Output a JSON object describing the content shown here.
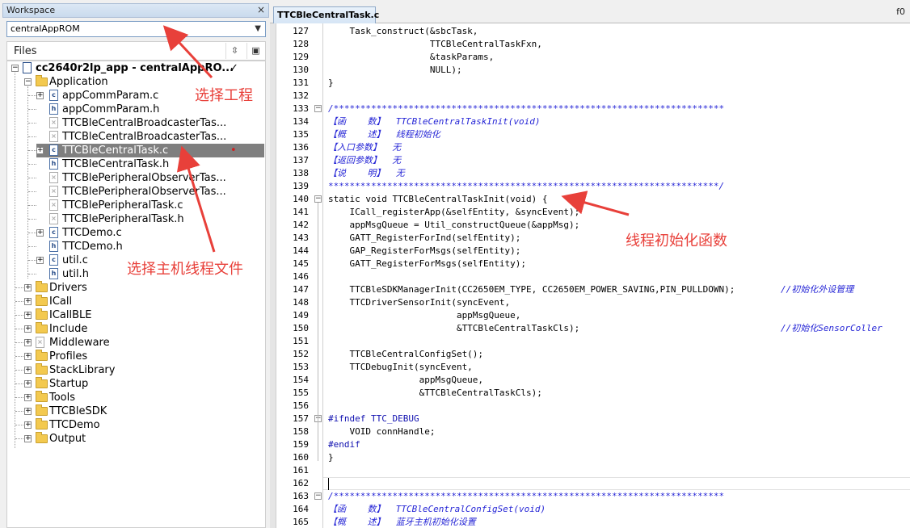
{
  "workspace": {
    "title": "Workspace",
    "close": "×",
    "config": "centralAppROM",
    "files_label": "Files",
    "btn_a": "⇳",
    "btn_b": "▣"
  },
  "tree": {
    "project": "cc2640r2lp_app - centralAppRO...",
    "project_check": "✓",
    "application": "Application",
    "items": [
      {
        "label": "appCommParam.c",
        "icon": "c",
        "exp": true
      },
      {
        "label": "appCommParam.h",
        "icon": "h",
        "exp": false
      },
      {
        "label": "TTCBleCentralBroadcasterTas...",
        "icon": "x",
        "exp": false
      },
      {
        "label": "TTCBleCentralBroadcasterTas...",
        "icon": "x",
        "exp": false
      },
      {
        "label": "TTCBleCentralTask.c",
        "icon": "c",
        "exp": true,
        "selected": true
      },
      {
        "label": "TTCBleCentralTask.h",
        "icon": "h",
        "exp": false
      },
      {
        "label": "TTCBlePeripheralObserverTas...",
        "icon": "x",
        "exp": false
      },
      {
        "label": "TTCBlePeripheralObserverTas...",
        "icon": "x",
        "exp": false
      },
      {
        "label": "TTCBlePeripheralTask.c",
        "icon": "x",
        "exp": false
      },
      {
        "label": "TTCBlePeripheralTask.h",
        "icon": "x",
        "exp": false
      },
      {
        "label": "TTCDemo.c",
        "icon": "c",
        "exp": true
      },
      {
        "label": "TTCDemo.h",
        "icon": "h",
        "exp": false
      },
      {
        "label": "util.c",
        "icon": "c",
        "exp": true
      },
      {
        "label": "util.h",
        "icon": "h",
        "exp": false
      }
    ],
    "groups": [
      "Drivers",
      "ICall",
      "ICallBLE",
      "Include",
      "Middleware",
      "Profiles",
      "StackLibrary",
      "Startup",
      "Tools",
      "TTCBleSDK",
      "TTCDemo",
      "Output"
    ]
  },
  "annotations": {
    "select_project": "选择工程",
    "select_file": "选择主机线程文件",
    "thread_init": "线程初始化函数"
  },
  "editor": {
    "tab": "TTCBleCentralTask.c",
    "func": "f0",
    "lines": [
      {
        "n": "127",
        "t": "    Task_construct(&sbcTask,"
      },
      {
        "n": "128",
        "t": "                   TTCBleCentralTaskFxn,"
      },
      {
        "n": "129",
        "t": "                   &taskParams,"
      },
      {
        "n": "130",
        "t": "                   NULL);"
      },
      {
        "n": "131",
        "t": "}"
      },
      {
        "n": "132",
        "t": ""
      },
      {
        "n": "133",
        "t": "/*************************************************************************",
        "cls": "c-cmt",
        "fold": true
      },
      {
        "n": "134",
        "t": "【函    数】  TTCBleCentralTaskInit(void)",
        "cls": "c-cmt"
      },
      {
        "n": "135",
        "t": "【概    述】  线程初始化",
        "cls": "c-cmt"
      },
      {
        "n": "136",
        "t": "【入口参数】  无",
        "cls": "c-cmt"
      },
      {
        "n": "137",
        "t": "【返回参数】  无",
        "cls": "c-cmt"
      },
      {
        "n": "138",
        "t": "【说    明】  无",
        "cls": "c-cmt"
      },
      {
        "n": "139",
        "t": "*************************************************************************/",
        "cls": "c-cmt"
      },
      {
        "n": "140",
        "t": "static void TTCBleCentralTaskInit(void) {",
        "fold": true
      },
      {
        "n": "141",
        "t": "    ICall_registerApp(&selfEntity, &syncEvent);"
      },
      {
        "n": "142",
        "t": "    appMsgQueue = Util_constructQueue(&appMsg);"
      },
      {
        "n": "143",
        "t": "    GATT_RegisterForInd(selfEntity);"
      },
      {
        "n": "144",
        "t": "    GAP_RegisterForMsgs(selfEntity);"
      },
      {
        "n": "145",
        "t": "    GATT_RegisterForMsgs(selfEntity);"
      },
      {
        "n": "146",
        "t": ""
      },
      {
        "n": "147",
        "t": "    TTCBleSDKManagerInit(CC2650EM_TYPE, CC2650EM_POWER_SAVING,PIN_PULLDOWN);",
        "cmt": "//初始化外设管理"
      },
      {
        "n": "148",
        "t": "    TTCDriverSensorInit(syncEvent,"
      },
      {
        "n": "149",
        "t": "                        appMsgQueue,"
      },
      {
        "n": "150",
        "t": "                        &TTCBleCentralTaskCls);",
        "cmt": "//初始化SensorColler"
      },
      {
        "n": "151",
        "t": ""
      },
      {
        "n": "152",
        "t": "    TTCBleCentralConfigSet();"
      },
      {
        "n": "153",
        "t": "    TTCDebugInit(syncEvent,"
      },
      {
        "n": "154",
        "t": "                 appMsgQueue,"
      },
      {
        "n": "155",
        "t": "                 &TTCBleCentralTaskCls);"
      },
      {
        "n": "156",
        "t": ""
      },
      {
        "n": "157",
        "t": "#ifndef TTC_DEBUG",
        "cls": "c-pp",
        "fold": true
      },
      {
        "n": "158",
        "t": "    VOID connHandle;"
      },
      {
        "n": "159",
        "t": "#endif",
        "cls": "c-pp"
      },
      {
        "n": "160",
        "t": "}"
      },
      {
        "n": "161",
        "t": ""
      },
      {
        "n": "162",
        "t": ""
      },
      {
        "n": "163",
        "t": "/*************************************************************************",
        "cls": "c-cmt",
        "fold": true
      },
      {
        "n": "164",
        "t": "【函    数】  TTCBleCentralConfigSet(void)",
        "cls": "c-cmt"
      },
      {
        "n": "165",
        "t": "【概    述】  蓝牙主机初始化设置",
        "cls": "c-cmt"
      }
    ]
  }
}
